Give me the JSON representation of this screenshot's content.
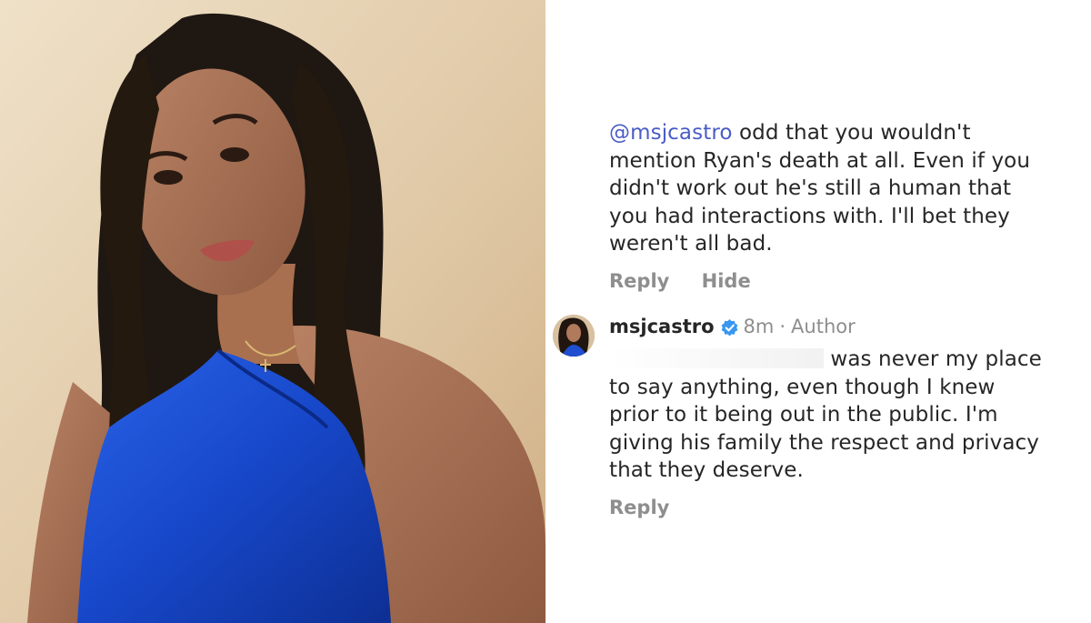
{
  "photo": {
    "subject": "woman-in-blue-dress-portrait-icon"
  },
  "comments": [
    {
      "mention": "@msjcastro",
      "text_lines": [
        " odd that you wouldn't",
        "mention Ryan's death at all. Even if you",
        "didn't work out he's still a human that",
        "you had interactions with. I'll bet they",
        "weren't all bad."
      ],
      "actions": [
        "Reply",
        "Hide"
      ]
    },
    {
      "username": "msjcastro",
      "time": "8m",
      "separator": "·",
      "role": "Author",
      "text_lines": [
        "was never my place",
        "to say anything, even though I knew",
        "prior to it being out in the public. I'm",
        "giving his family the respect and privacy",
        "that they deserve."
      ],
      "actions": [
        "Reply"
      ]
    }
  ],
  "colors": {
    "mention": "#4a5cc7",
    "text": "#262626",
    "muted": "#8e8e8e",
    "verified": "#3897f0",
    "dress": "#1a4fd6"
  }
}
